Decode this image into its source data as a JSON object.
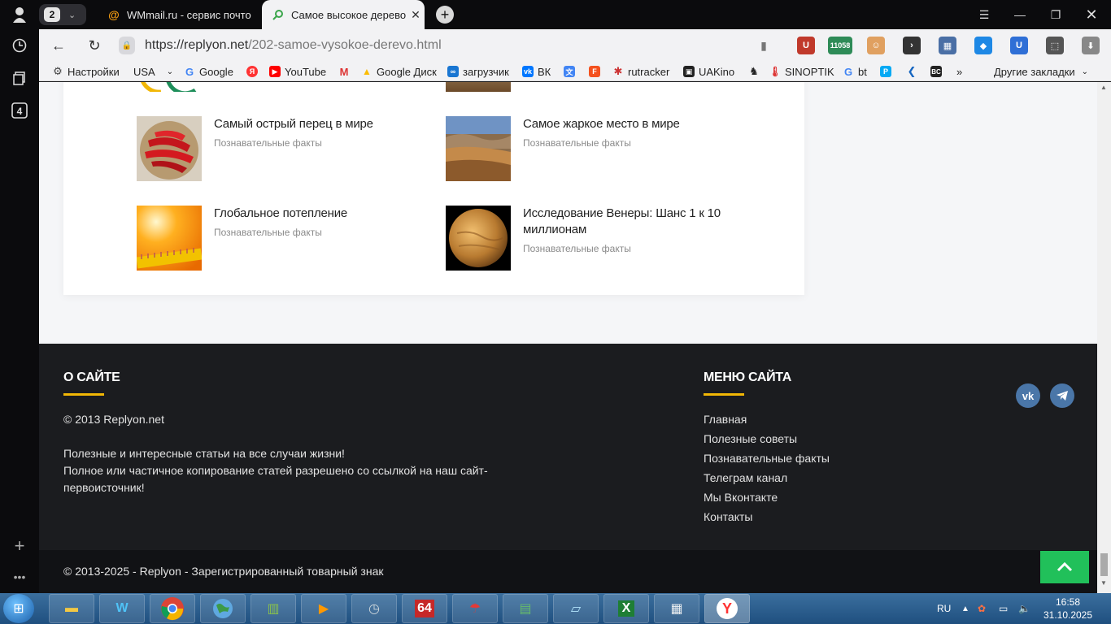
{
  "browser": {
    "tab_count": "2",
    "tabs": [
      {
        "title": "WMmail.ru - сервис почто",
        "icon": "at-icon"
      },
      {
        "title": "Самое высокое дерево",
        "icon": "search-icon"
      }
    ],
    "url_host": "https://replyon.net",
    "url_path": "/202-samoe-vysokoe-derevo.html",
    "extension_badge": "11058"
  },
  "bookmarks": [
    {
      "label": "Настройки",
      "icon": "gear-icon"
    },
    {
      "label": "USA",
      "icon": ""
    },
    {
      "label": "Google",
      "icon": "google-icon"
    },
    {
      "label": "",
      "icon": "yandex-icon"
    },
    {
      "label": "YouTube",
      "icon": "youtube-icon"
    },
    {
      "label": "",
      "icon": "gmail-icon"
    },
    {
      "label": "Google Диск",
      "icon": "drive-icon"
    },
    {
      "label": "загрузчик",
      "icon": "loader-icon"
    },
    {
      "label": "ВК",
      "icon": "vk-icon"
    },
    {
      "label": "",
      "icon": "translate-icon"
    },
    {
      "label": "",
      "icon": "f-icon"
    },
    {
      "label": "rutracker",
      "icon": "rutracker-icon"
    },
    {
      "label": "UAKino",
      "icon": "uakino-icon"
    },
    {
      "label": "",
      "icon": "chess-icon"
    },
    {
      "label": "SINOPTIK",
      "icon": "thermometer-icon"
    },
    {
      "label": "bt",
      "icon": "google-icon"
    },
    {
      "label": "",
      "icon": "p-icon"
    },
    {
      "label": "",
      "icon": "arrow-icon"
    },
    {
      "label": "",
      "icon": "bc-icon"
    }
  ],
  "bookmarks_more": "»",
  "other_bookmarks": "Другие закладки",
  "articles": [
    {
      "title": "Самый острый перец в мире",
      "category": "Познавательные факты"
    },
    {
      "title": "Самое жаркое место в мире",
      "category": "Познавательные факты"
    },
    {
      "title": "Глобальное потепление",
      "category": "Познавательные факты"
    },
    {
      "title": "Исследование Венеры: Шанс 1 к 10 миллионам",
      "category": "Познавательные факты"
    }
  ],
  "footer": {
    "about_title": "О САЙТЕ",
    "about_copyright": "© 2013 Replyon.net",
    "about_text_1": "Полезные и интересные статьи на все случаи жизни!",
    "about_text_2": "Полное или частичное копирование статей разрешено со ссылкой на наш сайт-первоисточник!",
    "menu_title": "МЕНЮ САЙТА",
    "menu": [
      "Главная",
      "Полезные советы",
      "Познавательные факты",
      "Телеграм канал",
      "Мы Вконтакте",
      "Контакты"
    ],
    "bottom_copyright": "© 2013-2025 - Replyon - Зарегистрированный товарный знак"
  },
  "taskbar": {
    "lang": "RU",
    "time": "16:58",
    "date": "31.10.2025",
    "app_64_label": "64"
  }
}
